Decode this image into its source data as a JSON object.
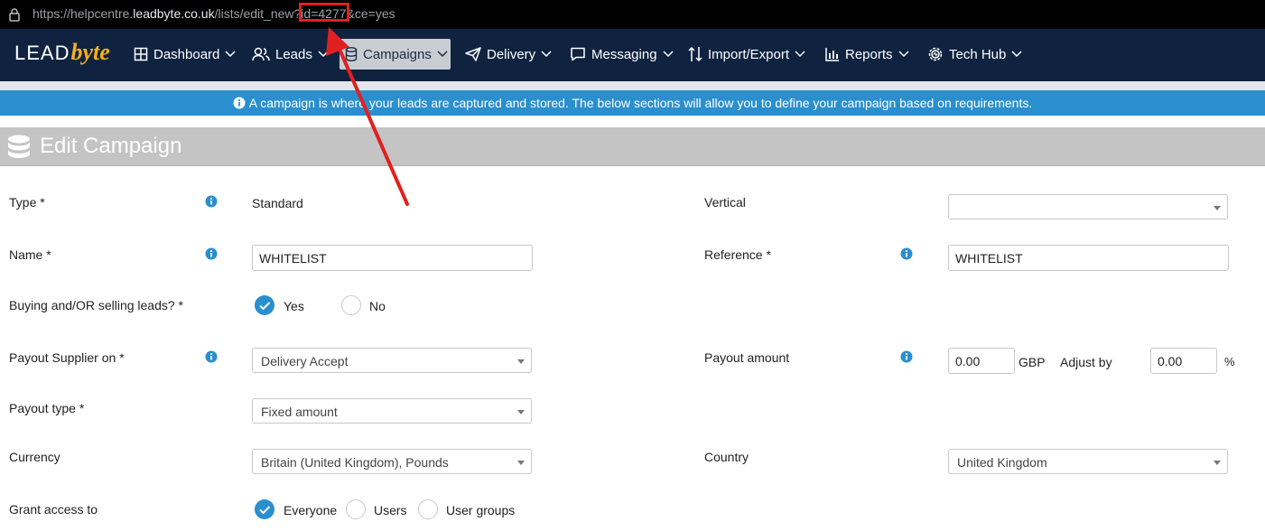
{
  "browser": {
    "url_prefix": "https://helpcentre.",
    "url_host": "leadbyte.co.uk",
    "url_path": "/lists/edit_new?id=4277&ce=yes",
    "icon": "lock-icon"
  },
  "logo": {
    "part1": "LEAD",
    "part2": "byte"
  },
  "nav": {
    "items": [
      {
        "label": "Dashboard",
        "icon": "grid-icon"
      },
      {
        "label": "Leads",
        "icon": "users-icon"
      },
      {
        "label": "Campaigns",
        "icon": "database-icon"
      },
      {
        "label": "Delivery",
        "icon": "paper-plane-icon"
      },
      {
        "label": "Messaging",
        "icon": "chat-icon"
      },
      {
        "label": "Import/Export",
        "icon": "import-export-icon"
      },
      {
        "label": "Reports",
        "icon": "bar-chart-icon"
      },
      {
        "label": "Tech Hub",
        "icon": "cog-icon"
      }
    ]
  },
  "banner": {
    "text": "A campaign is where your leads are captured and stored. The below sections will allow you to define your campaign based on requirements."
  },
  "page": {
    "title": "Edit Campaign"
  },
  "form": {
    "type": {
      "label": "Type *",
      "value": "Standard"
    },
    "vertical": {
      "label": "Vertical",
      "value": ""
    },
    "name": {
      "label": "Name *",
      "value": "WHITELIST"
    },
    "reference": {
      "label": "Reference *",
      "value": "WHITELIST"
    },
    "buying": {
      "label": "Buying and/OR selling leads? *",
      "options": [
        "Yes",
        "No"
      ],
      "selected": "Yes"
    },
    "payout_supplier": {
      "label": "Payout Supplier on *",
      "value": "Delivery Accept"
    },
    "payout_amount": {
      "label": "Payout amount",
      "value": "0.00",
      "currency": "GBP",
      "adjust_label": "Adjust by",
      "adjust_value": "0.00",
      "adjust_unit": "%"
    },
    "payout_type": {
      "label": "Payout type *",
      "value": "Fixed amount"
    },
    "currency": {
      "label": "Currency",
      "value": "Britain (United Kingdom), Pounds"
    },
    "country": {
      "label": "Country",
      "value": "United Kingdom"
    },
    "grant": {
      "label": "Grant access to",
      "options": [
        "Everyone",
        "Users",
        "User groups"
      ],
      "selected": "Everyone"
    }
  },
  "colors": {
    "navbar": "#0f2340",
    "banner": "#2a8fce",
    "accent": "#2a8fce",
    "logo_accent": "#f2b11c",
    "annotation": "#e02020"
  }
}
